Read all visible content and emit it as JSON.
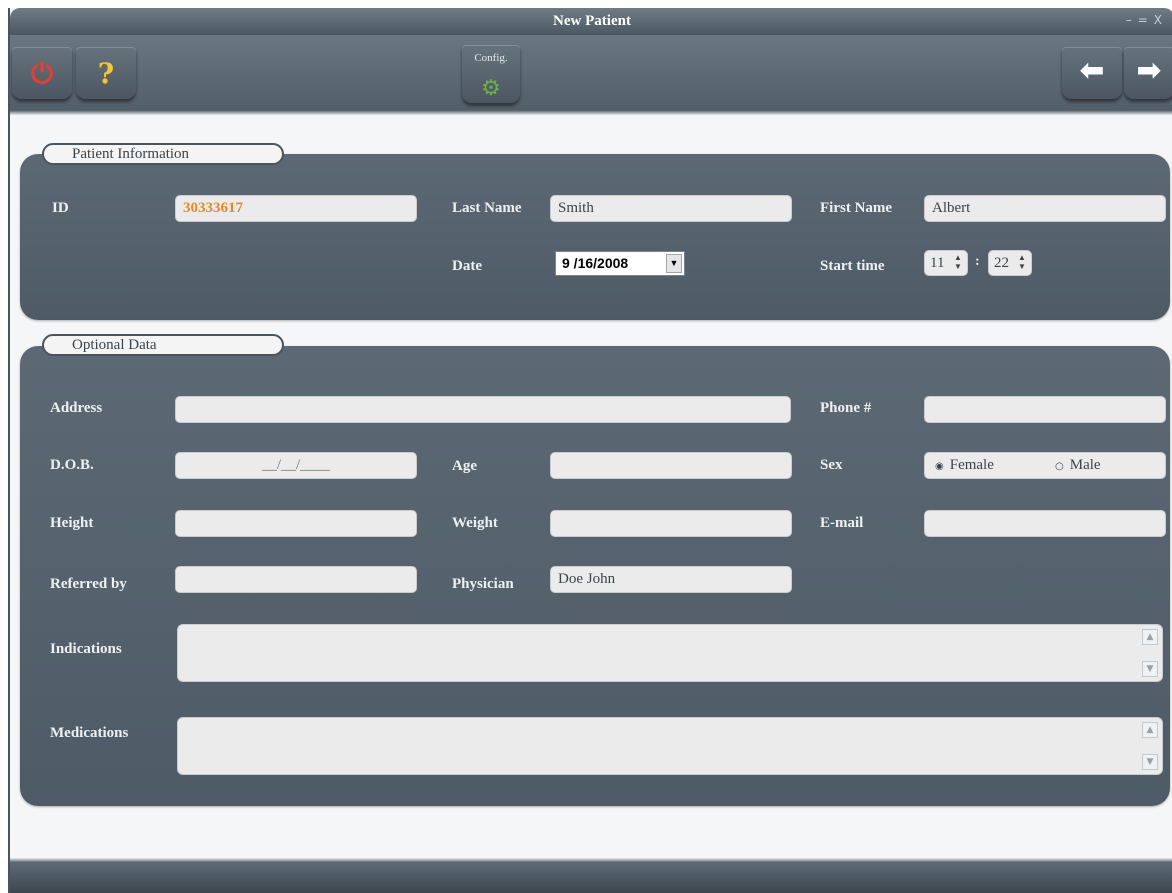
{
  "window": {
    "title": "New Patient",
    "controls": [
      "–",
      "=",
      "X"
    ]
  },
  "toolbar": {
    "power_glyph": "⏻",
    "help_glyph": "?",
    "config_label": "Config.",
    "config_glyph": "⚙",
    "back_glyph": "⬅",
    "forward_glyph": "➡"
  },
  "patient_info": {
    "section_label": "Patient Information",
    "id_label": "ID",
    "id_value": "30333617",
    "last_name_label": "Last Name",
    "last_name_value": "Smith",
    "first_name_label": "First Name",
    "first_name_value": "Albert",
    "date_label": "Date",
    "date_value": "9 /16/2008",
    "start_time_label": "Start time",
    "hour_value": "11",
    "minute_value": "22",
    "time_separator": ":"
  },
  "optional": {
    "section_label": "Optional Data",
    "address_label": "Address",
    "address_value": "",
    "phone_label": "Phone #",
    "phone_value": "",
    "dob_label": "D.O.B.",
    "dob_value": "__/__/____",
    "age_label": "Age",
    "age_value": "",
    "sex_label": "Sex",
    "sex_options": [
      "Female",
      "Male"
    ],
    "sex_selected": "Female",
    "height_label": "Height",
    "height_value": "",
    "weight_label": "Weight",
    "weight_value": "",
    "email_label": "E-mail",
    "email_value": "",
    "referred_label": "Referred by",
    "referred_value": "",
    "physician_label": "Physician",
    "physician_value": "Doe John",
    "indications_label": "Indications",
    "indications_value": "",
    "medications_label": "Medications",
    "medications_value": ""
  },
  "colors": {
    "panel": "#56636e",
    "accent_id": "#e58a1e",
    "power": "#ec3b32",
    "help": "#f0c93a",
    "config": "#6ab04c"
  }
}
